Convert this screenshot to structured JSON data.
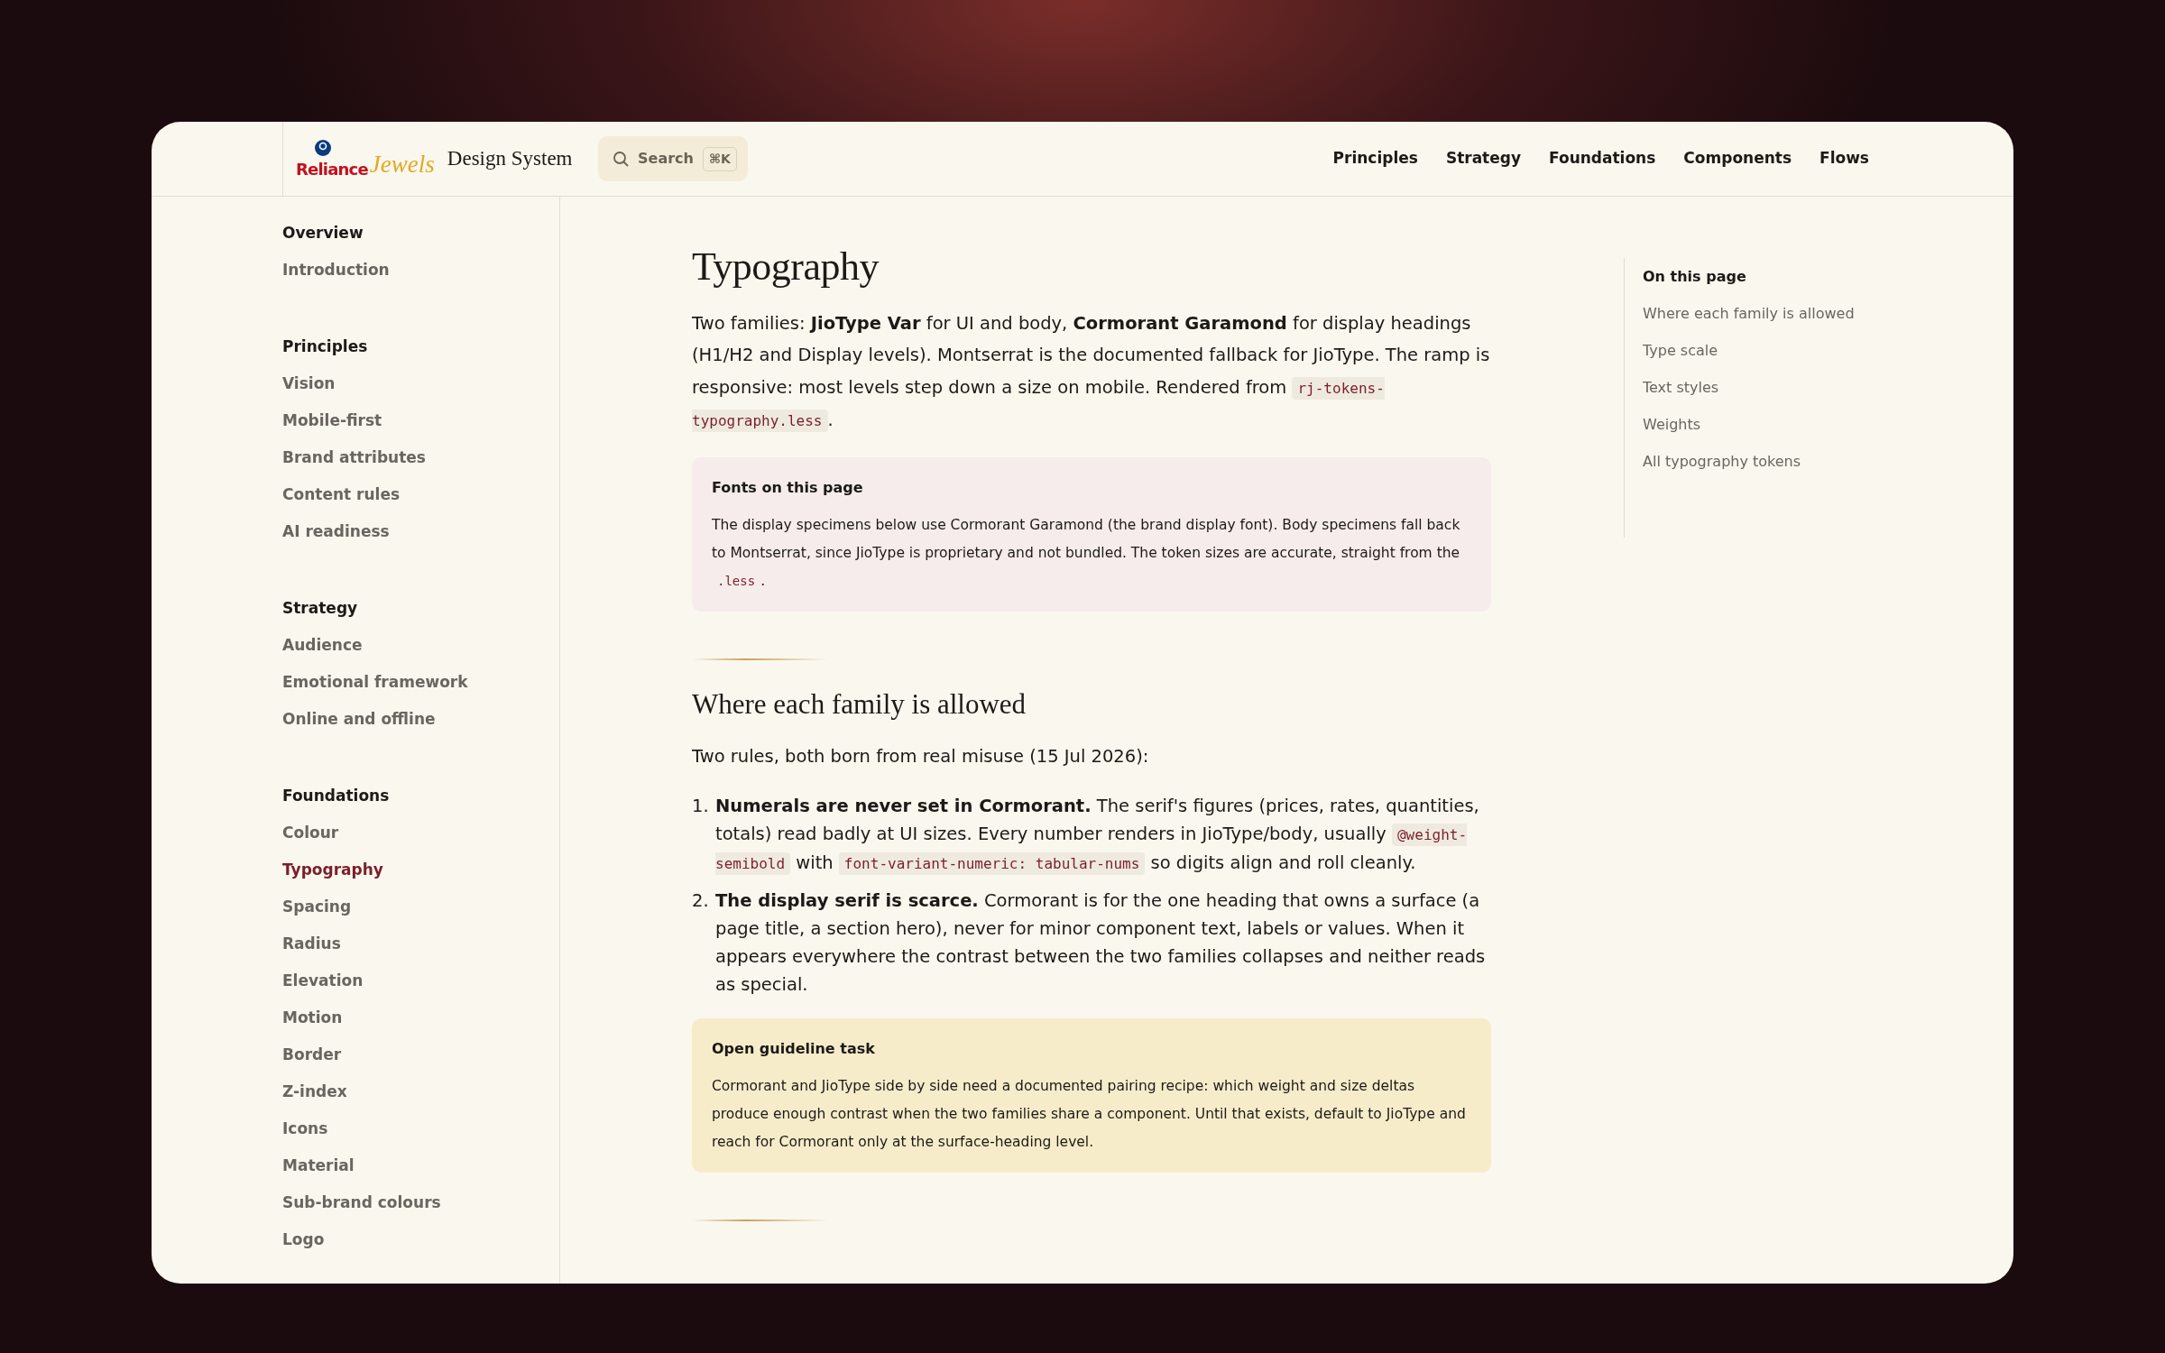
{
  "header": {
    "brand": {
      "primary": "Reliance",
      "script": "Jewels",
      "product": "Design System"
    },
    "search": {
      "label": "Search",
      "shortcut": "⌘K"
    },
    "nav": [
      {
        "label": "Principles"
      },
      {
        "label": "Strategy"
      },
      {
        "label": "Foundations"
      },
      {
        "label": "Components"
      },
      {
        "label": "Flows"
      }
    ]
  },
  "sidebar": {
    "groups": [
      {
        "title": "Overview",
        "items": [
          {
            "label": "Introduction",
            "selected": false
          }
        ]
      },
      {
        "title": "Principles",
        "items": [
          {
            "label": "Vision",
            "selected": false
          },
          {
            "label": "Mobile-first",
            "selected": false
          },
          {
            "label": "Brand attributes",
            "selected": false
          },
          {
            "label": "Content rules",
            "selected": false
          },
          {
            "label": "AI readiness",
            "selected": false
          }
        ]
      },
      {
        "title": "Strategy",
        "items": [
          {
            "label": "Audience",
            "selected": false
          },
          {
            "label": "Emotional framework",
            "selected": false
          },
          {
            "label": "Online and offline",
            "selected": false
          }
        ]
      },
      {
        "title": "Foundations",
        "items": [
          {
            "label": "Colour",
            "selected": false
          },
          {
            "label": "Typography",
            "selected": true
          },
          {
            "label": "Spacing",
            "selected": false
          },
          {
            "label": "Radius",
            "selected": false
          },
          {
            "label": "Elevation",
            "selected": false
          },
          {
            "label": "Motion",
            "selected": false
          },
          {
            "label": "Border",
            "selected": false
          },
          {
            "label": "Z-index",
            "selected": false
          },
          {
            "label": "Icons",
            "selected": false
          },
          {
            "label": "Material",
            "selected": false
          },
          {
            "label": "Sub-brand colours",
            "selected": false
          },
          {
            "label": "Logo",
            "selected": false
          }
        ]
      }
    ]
  },
  "content": {
    "title": "Typography",
    "blocks": [
      {
        "kind": "paragraph",
        "segments": [
          {
            "kind": "text",
            "text": "Two families: **JioType Var** for UI and body, **Cormorant Garamond** for display headings (H1/H2 and Display levels). Montserrat is the documented fallback for JioType. The ramp is responsive: most levels step down a size on mobile. Rendered from "
          },
          {
            "kind": "code",
            "text": "rj-tokens-typography.less"
          },
          {
            "kind": "text",
            "text": "."
          }
        ]
      },
      {
        "kind": "callout",
        "color": "#f6eceb",
        "title": "Fonts on this page",
        "segments": [
          {
            "kind": "text",
            "text": "The display specimens below use Cormorant Garamond (the brand display font). Body specimens fall back to Montserrat, since JioType is proprietary and not bundled. The token sizes are accurate, straight from the "
          },
          {
            "kind": "code",
            "text": ".less"
          },
          {
            "kind": "text",
            "text": "."
          }
        ]
      },
      {
        "kind": "divider"
      },
      {
        "kind": "heading",
        "text": "Where each family is allowed"
      },
      {
        "kind": "paragraph",
        "segments": [
          {
            "kind": "text",
            "text": "Two rules, both born from real misuse (15 Jul 2026):"
          }
        ]
      },
      {
        "kind": "list",
        "items": [
          {
            "marker": "1.",
            "segments": [
              {
                "kind": "text",
                "text": "**Numerals are never set in Cormorant.** The serif's figures (prices, rates, quantities, totals) read badly at UI sizes. Every number renders in JioType/body, usually "
              },
              {
                "kind": "code",
                "text": "@weight-semibold"
              },
              {
                "kind": "text",
                "text": " with "
              },
              {
                "kind": "code",
                "text": "font-variant-numeric: tabular-nums"
              },
              {
                "kind": "text",
                "text": " so digits align and roll cleanly."
              }
            ]
          },
          {
            "marker": "2.",
            "segments": [
              {
                "kind": "text",
                "text": "**The display serif is scarce.** Cormorant is for the one heading that owns a surface (a page title, a section hero), never for minor component text, labels or values. When it appears everywhere the contrast between the two families collapses and neither reads as special."
              }
            ]
          }
        ]
      },
      {
        "kind": "callout",
        "color": "#f7ecca",
        "title": "Open guideline task",
        "segments": [
          {
            "kind": "text",
            "text": "Cormorant and JioType side by side need a documented pairing recipe: which weight and size deltas produce enough contrast when the two families share a component. Until that exists, default to JioType and reach for Cormorant only at the surface-heading level."
          }
        ]
      },
      {
        "kind": "divider"
      }
    ]
  },
  "toc": {
    "title": "On this page",
    "items": [
      {
        "label": "Where each family is allowed"
      },
      {
        "label": "Type scale"
      },
      {
        "label": "Text styles"
      },
      {
        "label": "Weights"
      },
      {
        "label": "All typography tokens"
      }
    ]
  }
}
